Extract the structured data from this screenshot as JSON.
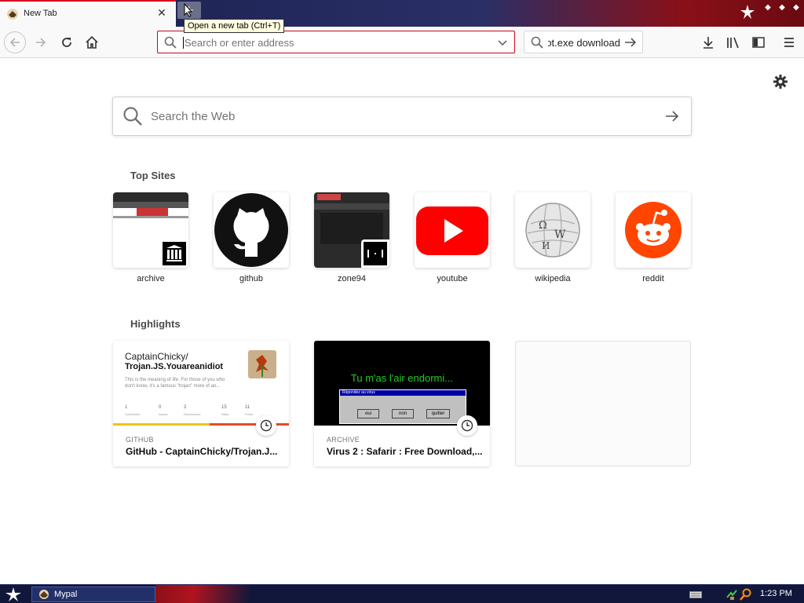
{
  "tab": {
    "title": "New Tab",
    "close": "✕"
  },
  "tooltip": "Open a new tab (Ctrl+T)",
  "urlbar": {
    "placeholder": "Search or enter address"
  },
  "searchbar": {
    "value": "ot.exe download"
  },
  "content": {
    "web_search_placeholder": "Search the Web",
    "top_sites_title": "Top Sites",
    "top_sites": [
      {
        "label": "archive",
        "icon": "archive-icon"
      },
      {
        "label": "github",
        "icon": "github-icon"
      },
      {
        "label": "zone94",
        "icon": "zone94-icon"
      },
      {
        "label": "youtube",
        "icon": "youtube-icon"
      },
      {
        "label": "wikipedia",
        "icon": "wikipedia-icon"
      },
      {
        "label": "reddit",
        "icon": "reddit-icon"
      }
    ],
    "highlights_title": "Highlights",
    "highlights": [
      {
        "source": "GITHUB",
        "title": "GitHub - CaptainChicky/Trojan.J...",
        "thumb": {
          "repo_owner": "CaptainChicky/",
          "repo_name": "Trojan.JS.Youareanidiot",
          "desc_line1": "This is the meaning of life. For those of you who",
          "desc_line2": "don't know, it's a famous \"trojan\" more of an...",
          "stats": [
            "1",
            "0",
            "2",
            "15",
            "11"
          ],
          "stat_labels": [
            "Contributor",
            "Issues",
            "Discussions",
            "Stars",
            "Forks"
          ]
        }
      },
      {
        "source": "ARCHIVE",
        "title": "Virus 2 : Safarir : Free Download,...",
        "thumb": {
          "headline": "Tu m'as l'air endormi...",
          "dialog_title": "Répondez au virus",
          "buttons": [
            "oui",
            "non",
            "quitter"
          ]
        }
      }
    ]
  },
  "taskbar": {
    "app_label": "Mypal",
    "time": "1:23 PM"
  },
  "colors": {
    "accent": "#d70022",
    "youtube": "#ff0000",
    "reddit": "#ff4500"
  }
}
